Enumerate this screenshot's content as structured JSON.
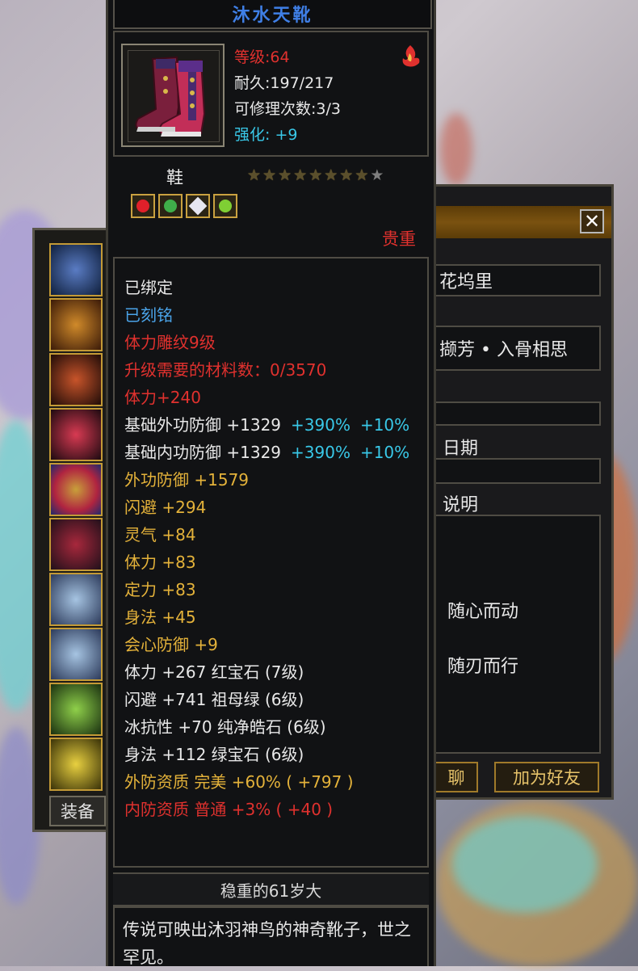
{
  "item": {
    "name": "沐水天靴",
    "level_label": "等级:64",
    "durability_label": "耐久:197/217",
    "repair_label": "可修理次数:3/3",
    "enhance_label": "强化: +9",
    "slot_label": "鞋",
    "stars_filled": 8,
    "stars_total": 9,
    "binding_label": "贵重"
  },
  "properties": [
    {
      "text": "已绑定",
      "color": "white"
    },
    {
      "text": "已刻铭",
      "color": "blue"
    },
    {
      "text": "体力雕纹9级",
      "color": "red"
    },
    {
      "text": "升级需要的材料数：0/3570",
      "color": "red"
    },
    {
      "text": "体力+240",
      "color": "red"
    },
    {
      "text": "基础外功防御  +1329",
      "color": "white",
      "extra1": "+390%",
      "extra2": "+10%"
    },
    {
      "text": "基础内功防御  +1329",
      "color": "white",
      "extra1": "+390%",
      "extra2": "+10%"
    },
    {
      "text": "外功防御  +1579",
      "color": "gold"
    },
    {
      "text": "闪避  +294",
      "color": "gold"
    },
    {
      "text": "灵气  +84",
      "color": "gold"
    },
    {
      "text": "体力  +83",
      "color": "gold"
    },
    {
      "text": "定力  +83",
      "color": "gold"
    },
    {
      "text": "身法  +45",
      "color": "gold"
    },
    {
      "text": "会心防御  +9",
      "color": "gold"
    },
    {
      "text": "体力  +267  红宝石 (7级)",
      "color": "white"
    },
    {
      "text": "闪避  +741  祖母绿 (6级)",
      "color": "white"
    },
    {
      "text": "冰抗性  +70  纯净皓石 (6级)",
      "color": "white"
    },
    {
      "text": "身法  +112  绿宝石 (6级)",
      "color": "white"
    },
    {
      "text": "外防资质    完美  +60%  ( +797 )",
      "color": "gold"
    },
    {
      "text": "内防资质    普通  +3%  ( +40 )",
      "color": "red"
    }
  ],
  "mark_title": "稳重的61岁大",
  "description": "传说可映出沐羽神鸟的神奇靴子，世之罕见。",
  "equip_panel": {
    "button_label": "装备"
  },
  "right_panel": {
    "field1": "花坞里",
    "field2": "撷芳 • 入骨相思",
    "label_date": "日期",
    "label_desc": "说明",
    "text1": "随心而动",
    "text2": "随刃而行",
    "btn_chat": "聊",
    "btn_add_friend": "加为好友",
    "close_symbol": "✕"
  },
  "colors": {
    "title_blue": "#3f7fe6",
    "red": "#e0312e",
    "gold": "#e4b23a",
    "cyan": "#39c8e8",
    "white": "#e8e8e8",
    "blue": "#4aa3e8"
  }
}
